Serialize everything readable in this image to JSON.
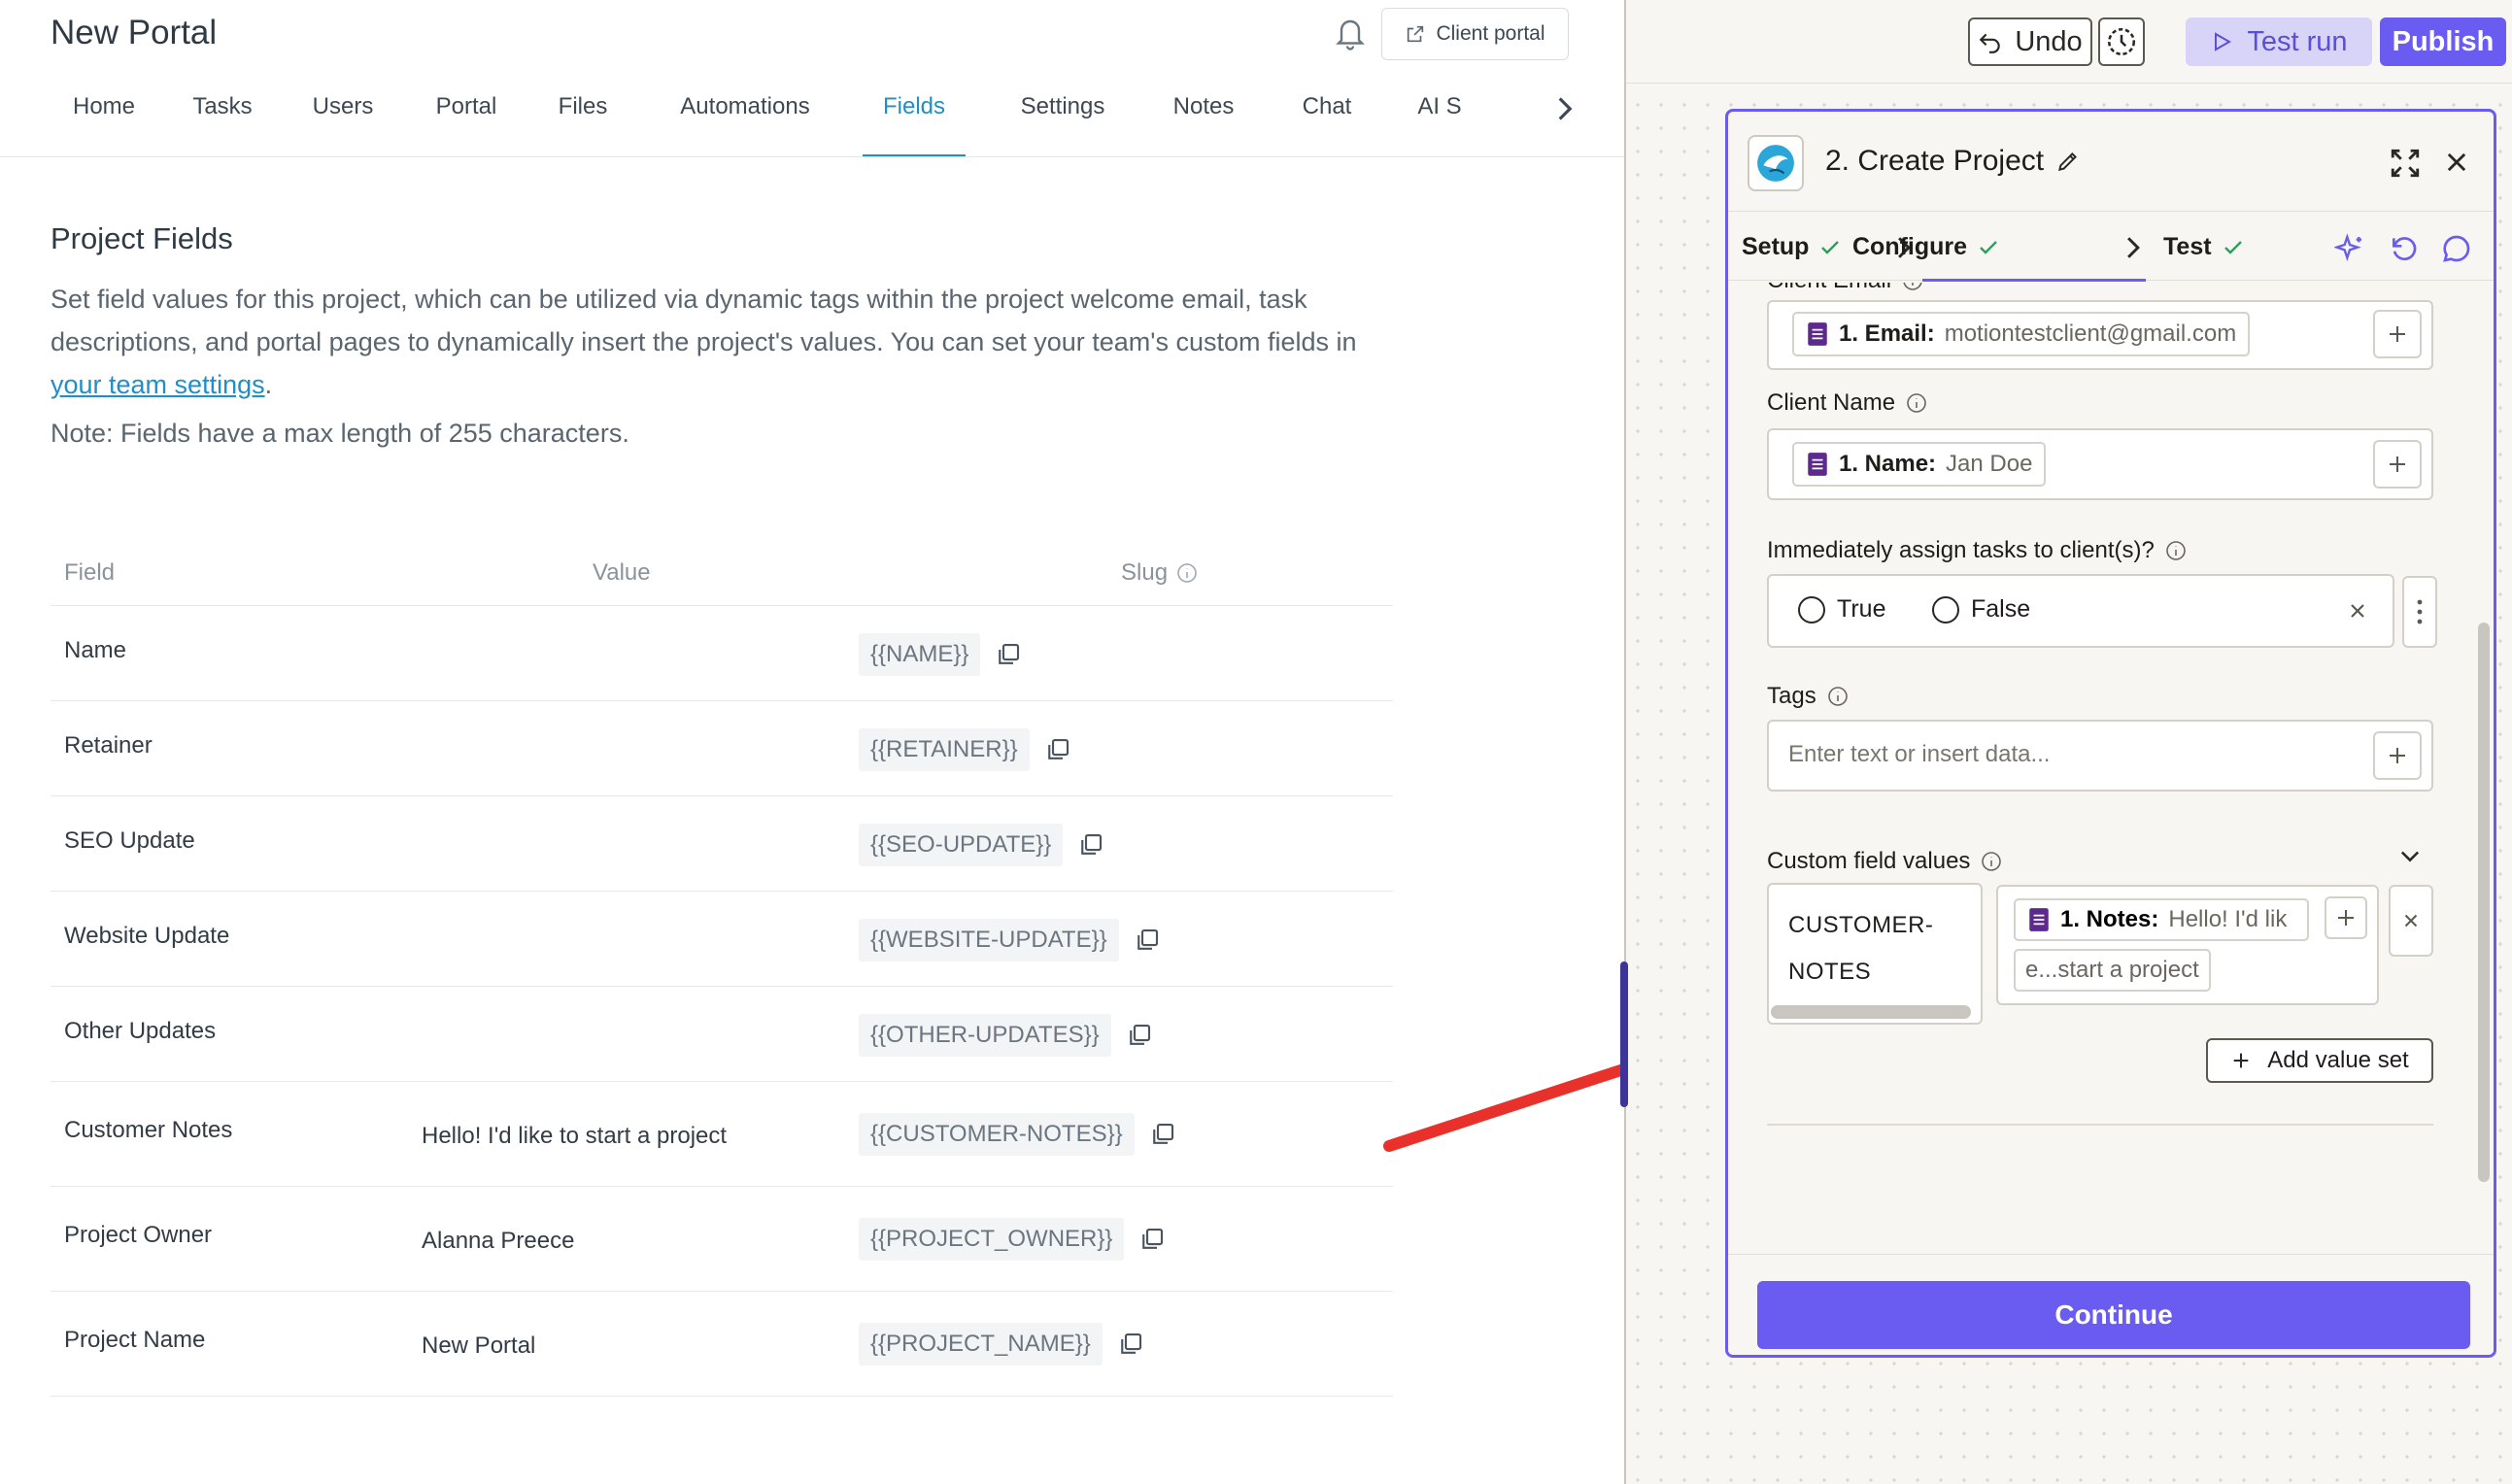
{
  "left": {
    "portal_title": "New Portal",
    "client_portal_label": "Client portal",
    "nav": [
      "Home",
      "Tasks",
      "Users",
      "Portal",
      "Files",
      "Automations",
      "Fields",
      "Settings",
      "Notes",
      "Chat",
      "AI S"
    ],
    "active_nav": "Fields",
    "section_title": "Project Fields",
    "desc_before_link": "Set field values for this project, which can be utilized via dynamic tags within the project welcome email, task descriptions, and portal pages to dynamically insert the project's values. You can set your team's custom fields in ",
    "desc_link": "your team settings",
    "desc_after_link": ".",
    "note": "Note: Fields have a max length of 255 characters.",
    "table_headers": {
      "field": "Field",
      "value": "Value",
      "slug": "Slug"
    },
    "rows": [
      {
        "field": "Name",
        "value": "",
        "slug": "{{NAME}}"
      },
      {
        "field": "Retainer",
        "value": "",
        "slug": "{{RETAINER}}"
      },
      {
        "field": "SEO Update",
        "value": "",
        "slug": "{{SEO-UPDATE}}"
      },
      {
        "field": "Website Update",
        "value": "",
        "slug": "{{WEBSITE-UPDATE}}"
      },
      {
        "field": "Other Updates",
        "value": "",
        "slug": "{{OTHER-UPDATES}}"
      },
      {
        "field": "Customer Notes",
        "value": "Hello! I'd like to start a project",
        "slug": "{{CUSTOMER-NOTES}}"
      },
      {
        "field": "Project Owner",
        "value": "Alanna Preece",
        "slug": "{{PROJECT_OWNER}}"
      },
      {
        "field": "Project Name",
        "value": "New Portal",
        "slug": "{{PROJECT_NAME}}"
      }
    ]
  },
  "right": {
    "undo_label": "Undo",
    "test_run_label": "Test run",
    "publish_label": "Publish",
    "dialog_title": "2. Create Project",
    "steps": [
      "Setup",
      "Configure",
      "Test"
    ],
    "client_email_label": "Client Email",
    "client_email_chip_key": "1. Email:",
    "client_email_chip_value": "motiontestclient@gmail.com",
    "client_name_label": "Client Name",
    "client_name_chip_key": "1. Name:",
    "client_name_chip_value": "Jan Doe",
    "assign_label": "Immediately assign tasks to client(s)?",
    "radio_true": "True",
    "radio_false": "False",
    "tags_label": "Tags",
    "tags_placeholder": "Enter text or insert data...",
    "custom_fields_label": "Custom field values",
    "custom_key": "CUSTOMER-NOTES",
    "custom_val_key": "1. Notes:",
    "custom_val_value": "Hello! I'd lik",
    "custom_val_cont": "e...start a project",
    "add_value_set_label": "Add value set",
    "continue_label": "Continue"
  },
  "colors": {
    "accent_blue": "#1d8fc9",
    "zap_purple": "#6a5cf0",
    "arrow_red": "#e8312a",
    "sheet_purple": "#5b2a8c"
  }
}
